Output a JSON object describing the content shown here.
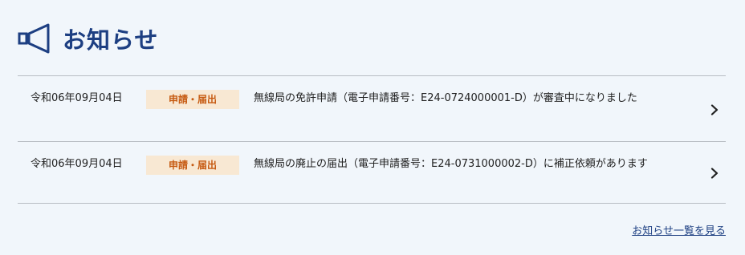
{
  "section": {
    "title": "お知らせ",
    "icon": "megaphone-icon",
    "accent_color": "#1d3f82"
  },
  "news": [
    {
      "date": "令和06年09月04日",
      "category": "申請・届出",
      "title": "無線局の免許申請（電子申請番号：E24-0724000001-D）が審査中になりました",
      "icon": "chevron-right-icon"
    },
    {
      "date": "令和06年09月04日",
      "category": "申請・届出",
      "title": "無線局の廃止の届出（電子申請番号：E24-0731000002-D）に補正依頼があります",
      "icon": "chevron-right-icon"
    }
  ],
  "footer": {
    "more_link": "お知らせ一覧を見る"
  },
  "colors": {
    "background": "#f1f6fb",
    "badge_bg": "#f8e8d3",
    "badge_text": "#c65a11"
  }
}
